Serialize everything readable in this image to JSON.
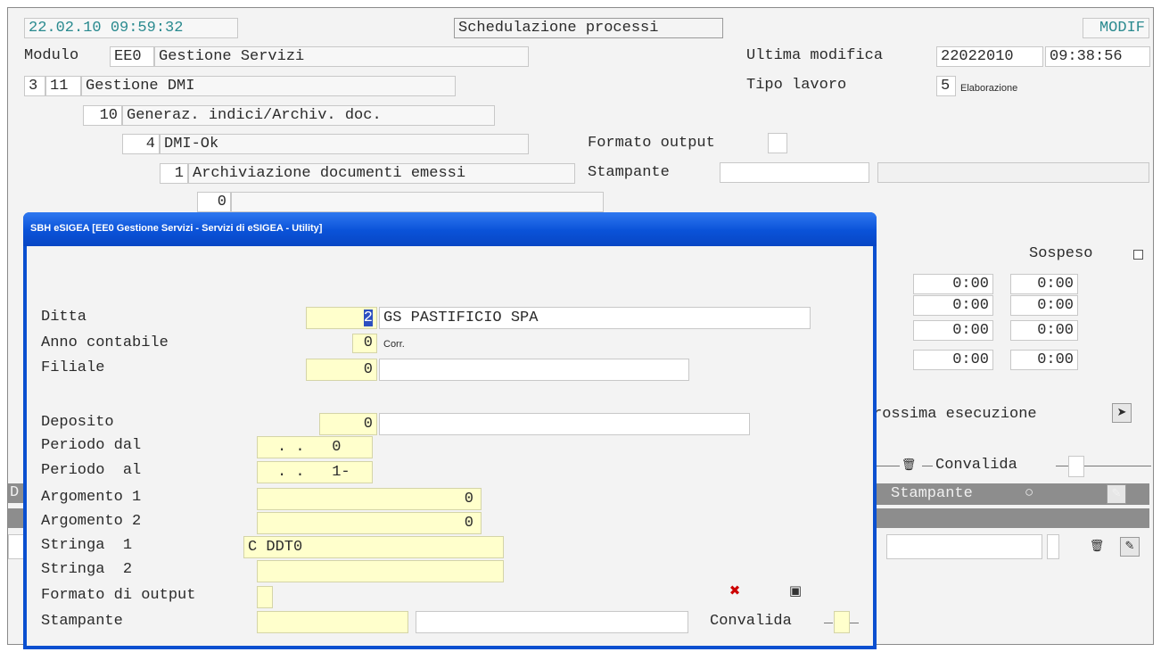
{
  "header": {
    "datetime": "22.02.10 09:59:32",
    "title": "Schedulazione processi",
    "mode": "MODIF",
    "modulo_label": "Modulo",
    "modulo_code": "EE0",
    "modulo_name": "Gestione Servizi",
    "ultima_modifica_label": "Ultima modifica",
    "ultima_modifica_date": "22022010",
    "ultima_modifica_time": "09:38:56",
    "tipo_lavoro_label": "Tipo lavoro",
    "tipo_lavoro_code": "5",
    "tipo_lavoro_value": "Elaborazione"
  },
  "tree": {
    "l1_a": "3",
    "l1_b": "11",
    "l1_name": "Gestione DMI",
    "l2_num": "10",
    "l2_name": "Generaz. indici/Archiv. doc.",
    "l3_num": "4",
    "l3_name": "DMI-Ok",
    "l4_num": "1",
    "l4_name": "Archiviazione documenti emessi",
    "l5_num": "0"
  },
  "output": {
    "formato_label": "Formato output",
    "stampante_label": "Stampante"
  },
  "right_panel": {
    "sospeso_label": "Sospeso",
    "times": [
      "0:00",
      "0:00",
      "0:00",
      "0:00",
      "0:00",
      "0:00",
      "0:00",
      "0:00"
    ],
    "prossima_label": "rossima esecuzione",
    "convalida_label": "Convalida",
    "stampante_label": "Stampante",
    "bar_radio": "○",
    "left_bar_char": "D"
  },
  "dialog": {
    "title": "SBH eSIGEA [EE0 Gestione Servizi - Servizi di eSIGEA - Utility]",
    "ditta_label": "Ditta",
    "ditta_code": "2",
    "ditta_name": "GS PASTIFICIO SPA",
    "anno_label": "Anno contabile",
    "anno_value": "0",
    "anno_note": "Corr.",
    "filiale_label": "Filiale",
    "filiale_value": "0",
    "deposito_label": "Deposito",
    "deposito_value": "0",
    "periodo_dal_label": "Periodo dal",
    "periodo_dal_value": ". .   0",
    "periodo_al_label": "Periodo  al",
    "periodo_al_value": ". .   1-",
    "arg1_label": "Argomento 1",
    "arg1_value": "0",
    "arg2_label": "Argomento 2",
    "arg2_value": "0",
    "str1_label": "Stringa  1",
    "str1_value": "C DDT0",
    "str2_label": "Stringa  2",
    "str2_value": "",
    "formato_label": "Formato di output",
    "stampante_label": "Stampante",
    "convalida_label": "Convalida"
  }
}
